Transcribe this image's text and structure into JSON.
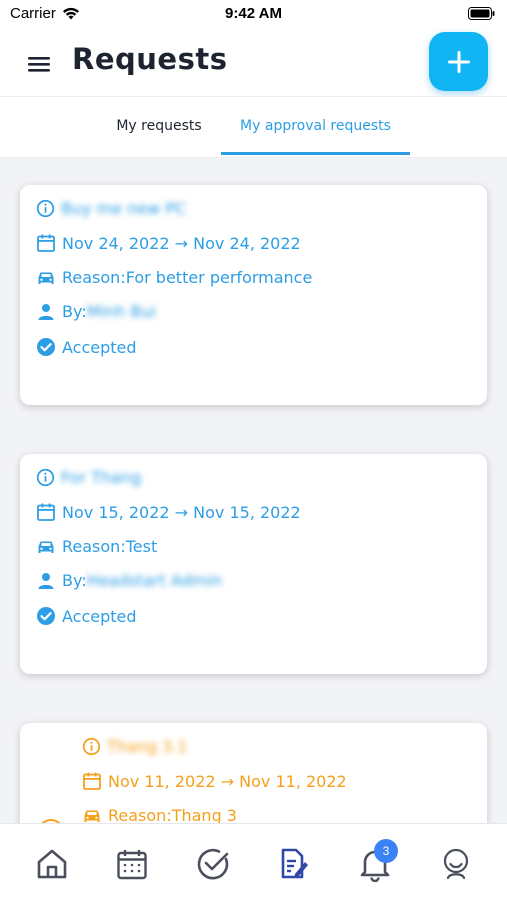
{
  "status_bar": {
    "carrier": "Carrier",
    "time": "9:42 AM"
  },
  "header": {
    "title": "Requests"
  },
  "tabs": [
    {
      "label": "My requests",
      "active": false
    },
    {
      "label": "My approval requests",
      "active": true
    }
  ],
  "labels": {
    "reason_prefix": "Reason: ",
    "by_prefix": "By: "
  },
  "requests": [
    {
      "title": "Buy me new PC",
      "date_range": "Nov 24, 2022 → Nov 24, 2022",
      "reason": "For better performance",
      "by": "Minh Bui",
      "status": "Accepted",
      "color": "#2d9ee5"
    },
    {
      "title": "For Thang",
      "date_range": "Nov 15, 2022 → Nov 15, 2022",
      "reason": "Test",
      "by": "Headstart Admin",
      "status": "Accepted",
      "color": "#2d9ee5"
    },
    {
      "title": "Thang 3.1",
      "date_range": "Nov 11, 2022 → Nov 11, 2022",
      "reason": "Thang 3",
      "by": "",
      "status": "",
      "color": "#f5a01a"
    }
  ],
  "bottom_nav": {
    "items": [
      "home-icon",
      "calendar-icon",
      "check-circle-icon",
      "requests-icon",
      "bell-icon",
      "profile-icon"
    ],
    "active": "requests-icon",
    "notification_count": "3"
  },
  "colors": {
    "accent": "#2d9ee5",
    "fab": "#12b5f3",
    "pending": "#f5a01a",
    "badge": "#3b82f6"
  }
}
